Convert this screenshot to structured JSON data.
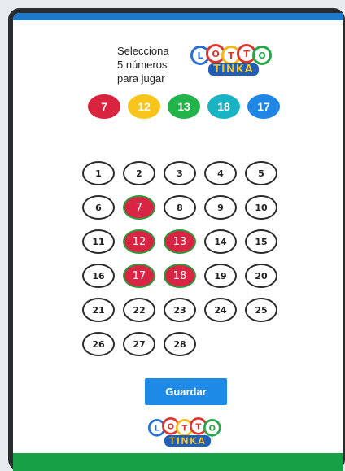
{
  "header": {
    "instruction_line1": "Selecciona",
    "instruction_line2": "5 números",
    "instruction_line3": "para jugar"
  },
  "logo": {
    "letters": [
      "L",
      "O",
      "T",
      "T",
      "O"
    ],
    "word": "TINKA"
  },
  "selected_numbers": [
    {
      "value": "7",
      "color": "#d9233f"
    },
    {
      "value": "12",
      "color": "#f7c51c"
    },
    {
      "value": "13",
      "color": "#22b34a"
    },
    {
      "value": "18",
      "color": "#19b3c4"
    },
    {
      "value": "17",
      "color": "#1f86e6"
    }
  ],
  "numbers": [
    {
      "label": "1",
      "selected": false
    },
    {
      "label": "2",
      "selected": false
    },
    {
      "label": "3",
      "selected": false
    },
    {
      "label": "4",
      "selected": false
    },
    {
      "label": "5",
      "selected": false
    },
    {
      "label": "6",
      "selected": false
    },
    {
      "label": "7",
      "selected": true
    },
    {
      "label": "8",
      "selected": false
    },
    {
      "label": "9",
      "selected": false
    },
    {
      "label": "10",
      "selected": false
    },
    {
      "label": "11",
      "selected": false
    },
    {
      "label": "12",
      "selected": true
    },
    {
      "label": "13",
      "selected": true
    },
    {
      "label": "14",
      "selected": false
    },
    {
      "label": "15",
      "selected": false
    },
    {
      "label": "16",
      "selected": false
    },
    {
      "label": "17",
      "selected": true
    },
    {
      "label": "18",
      "selected": true
    },
    {
      "label": "19",
      "selected": false
    },
    {
      "label": "20",
      "selected": false
    },
    {
      "label": "21",
      "selected": false
    },
    {
      "label": "22",
      "selected": false
    },
    {
      "label": "23",
      "selected": false
    },
    {
      "label": "24",
      "selected": false
    },
    {
      "label": "25",
      "selected": false
    },
    {
      "label": "26",
      "selected": false
    },
    {
      "label": "27",
      "selected": false
    },
    {
      "label": "28",
      "selected": false
    }
  ],
  "actions": {
    "save_label": "Guardar"
  },
  "colors": {
    "top_bar": "#1f79c9",
    "bottom_bar": "#18a046",
    "button": "#1d8ae8",
    "selected_cell": "#d92544"
  }
}
